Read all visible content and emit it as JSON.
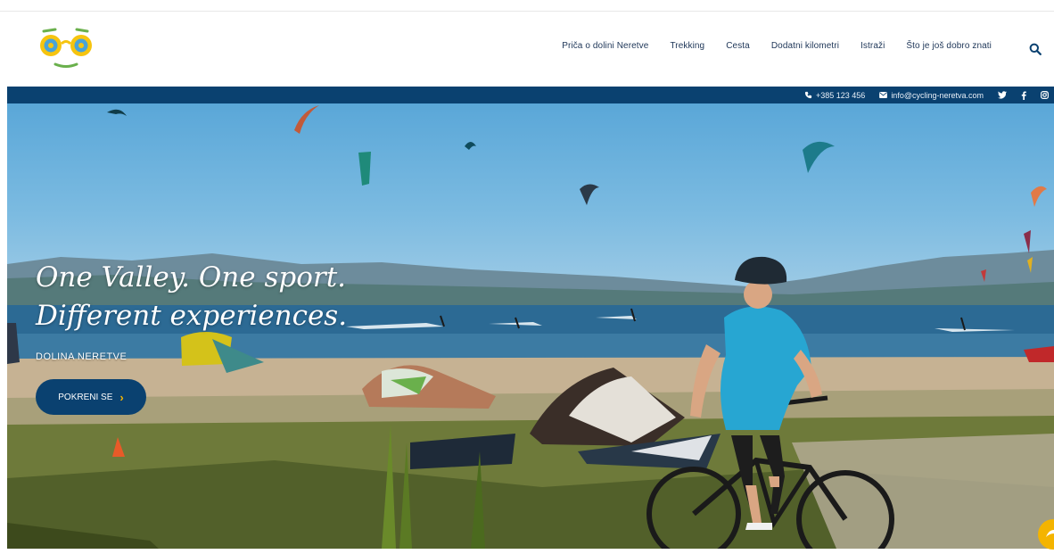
{
  "nav": {
    "items": [
      {
        "label": "Priča o dolini Neretve"
      },
      {
        "label": "Trekking"
      },
      {
        "label": "Cesta"
      },
      {
        "label": "Dodatni kilometri"
      },
      {
        "label": "Istraži"
      },
      {
        "label": "Što je još dobro znati"
      }
    ],
    "search_icon": "search-icon"
  },
  "contact": {
    "phone": "+385 123 456",
    "email": "info@cycling-neretva.com",
    "social": [
      "twitter-icon",
      "facebook-icon",
      "instagram-icon"
    ]
  },
  "hero": {
    "headline_line1": "One Valley. One sport.",
    "headline_line2": "Different experiences.",
    "subtitle": "DOLINA NERETVE",
    "cta_label": "POKRENI SE",
    "cta_icon": "chevron-right-icon"
  },
  "colors": {
    "brand_blue": "#0a4170",
    "accent_yellow": "#f4b400",
    "logo_green": "#6ab04c"
  }
}
